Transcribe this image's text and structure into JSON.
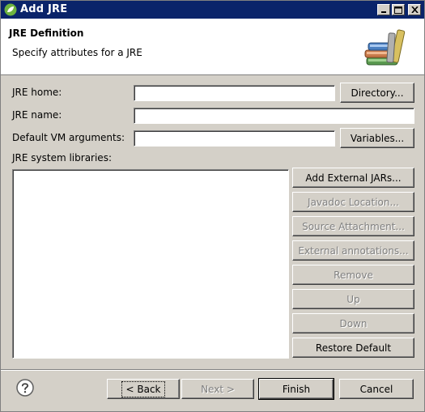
{
  "window": {
    "title": "Add JRE",
    "controls": {
      "minimize": "minimize",
      "maximize": "maximize",
      "close": "close"
    }
  },
  "banner": {
    "title": "JRE Definition",
    "message": "Specify attributes for a JRE",
    "icon": "library-books-icon"
  },
  "form": {
    "jre_home_label": "JRE home:",
    "jre_home_value": "",
    "directory_button": "Directory...",
    "jre_name_label": "JRE name:",
    "jre_name_value": "",
    "vm_args_label": "Default VM arguments:",
    "vm_args_value": "",
    "variables_button": "Variables...",
    "libraries_label": "JRE system libraries:"
  },
  "library_buttons": {
    "add_external_jars": "Add External JARs...",
    "javadoc_location": "Javadoc Location...",
    "source_attachment": "Source Attachment...",
    "external_annotations": "External annotations...",
    "remove": "Remove",
    "up": "Up",
    "down": "Down",
    "restore_default": "Restore Default"
  },
  "footer": {
    "back": "< Back",
    "next": "Next >",
    "finish": "Finish",
    "cancel": "Cancel",
    "help_icon": "help-icon"
  }
}
